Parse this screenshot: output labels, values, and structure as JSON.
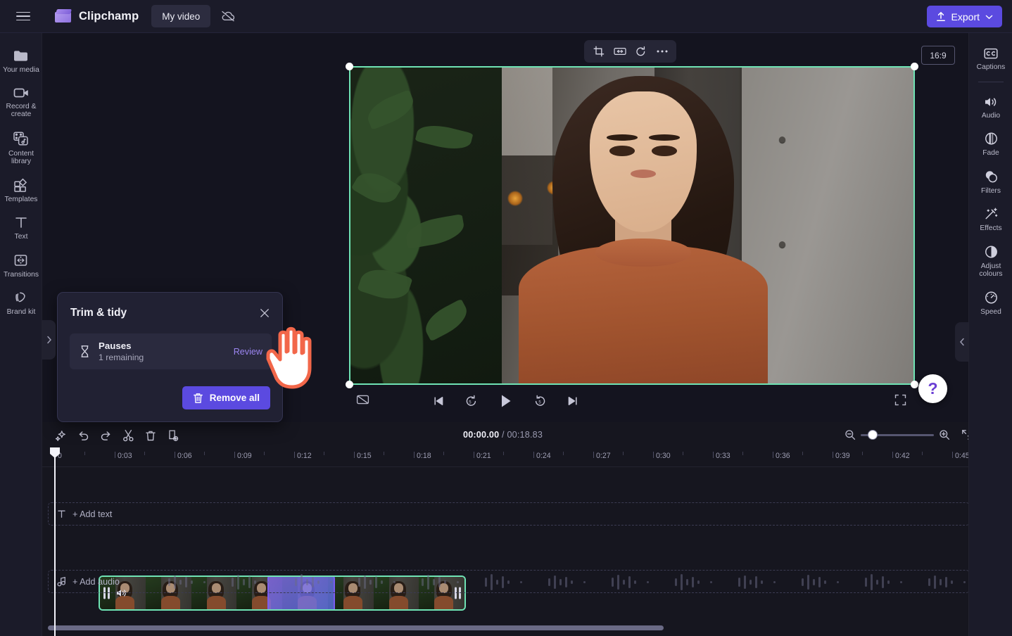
{
  "app": {
    "name": "Clipchamp",
    "project_tab": "My video",
    "export_label": "Export",
    "menu_icon": "hamburger-menu-icon",
    "cloud_icon": "cloud-off-icon"
  },
  "left_rail": {
    "items": [
      {
        "label": "Your media",
        "icon": "folder-icon"
      },
      {
        "label": "Record & create",
        "icon": "video-camera-icon"
      },
      {
        "label": "Content library",
        "icon": "content-library-icon"
      },
      {
        "label": "Templates",
        "icon": "templates-grid-icon"
      },
      {
        "label": "Text",
        "icon": "text-t-icon"
      },
      {
        "label": "Transitions",
        "icon": "transitions-icon"
      },
      {
        "label": "Brand kit",
        "icon": "brand-kit-icon"
      }
    ],
    "expand_icon": "chevron-right-icon"
  },
  "right_rail": {
    "items": [
      {
        "label": "Captions",
        "icon": "closed-captions-icon"
      },
      {
        "label": "Audio",
        "icon": "speaker-icon"
      },
      {
        "label": "Fade",
        "icon": "fade-icon"
      },
      {
        "label": "Filters",
        "icon": "filters-circles-icon"
      },
      {
        "label": "Effects",
        "icon": "magic-wand-icon"
      },
      {
        "label": "Adjust colours",
        "icon": "contrast-circle-icon"
      },
      {
        "label": "Speed",
        "icon": "speedometer-icon"
      }
    ],
    "collapse_icon": "chevron-left-icon"
  },
  "stage": {
    "aspect_ratio": "16:9",
    "float_toolbar": [
      {
        "icon": "crop-icon"
      },
      {
        "icon": "fit-to-width-icon"
      },
      {
        "icon": "rotate-icon"
      },
      {
        "icon": "more-options-icon"
      }
    ],
    "help_label": "?",
    "collapse_icon": "chevron-down-icon"
  },
  "player": {
    "captions_toggle_icon": "captions-off-icon",
    "skip_back_icon": "skip-to-start-icon",
    "rewind_icon": "rewind-5-seconds-icon",
    "play_icon": "play-icon",
    "forward_icon": "forward-5-seconds-icon",
    "skip_forward_icon": "skip-to-end-icon",
    "fullscreen_icon": "fullscreen-icon"
  },
  "dialog": {
    "title": "Trim & tidy",
    "close_icon": "close-x-icon",
    "row": {
      "icon": "hourglass-icon",
      "title": "Pauses",
      "subtitle": "1 remaining",
      "action_label": "Review"
    },
    "remove_all_label": "Remove all",
    "remove_all_icon": "trash-icon",
    "accent_color": "#5b4ae0"
  },
  "timeline": {
    "tools": [
      {
        "icon": "ai-sparkle-icon"
      },
      {
        "icon": "undo-icon"
      },
      {
        "icon": "redo-icon"
      },
      {
        "icon": "split-scissors-icon"
      },
      {
        "icon": "delete-trash-icon"
      },
      {
        "icon": "duplicate-icon"
      }
    ],
    "current_time": "00:00.00",
    "total_time": "00:18.83",
    "time_separator": "/",
    "zoom_out_icon": "zoom-out-icon",
    "zoom_in_icon": "zoom-in-icon",
    "fit_icon": "fit-timeline-icon",
    "ruler_labels": [
      "0",
      "0:03",
      "0:06",
      "0:09",
      "0:12",
      "0:15",
      "0:18",
      "0:21",
      "0:24",
      "0:27",
      "0:30",
      "0:33",
      "0:36",
      "0:39",
      "0:42",
      "0:45"
    ],
    "text_track_label": "+ Add text",
    "text_track_icon": "text-t-icon",
    "audio_track_label": "+ Add audio",
    "audio_track_icon": "music-note-icon",
    "clip": {
      "selection_color": "#6fe3b4",
      "pause_highlight_color": "#7b5cf0",
      "volume_icon": "speaker-icon",
      "grip_icon": "drag-handle-icon"
    }
  },
  "colors": {
    "accent": "#5b4ae0",
    "selection_green": "#6fe3b4",
    "pause_purple": "#7b5cf0",
    "background": "#14141f",
    "panel": "#1b1b29"
  }
}
